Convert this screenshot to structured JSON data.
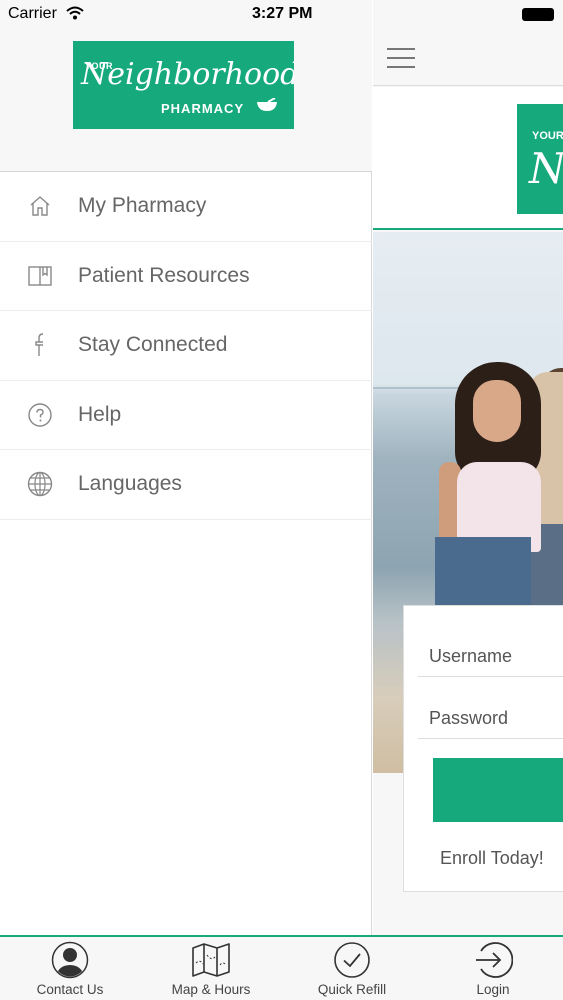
{
  "status_bar": {
    "carrier": "Carrier",
    "time": "3:27 PM"
  },
  "drawer": {
    "logo": {
      "your": "YOUR",
      "script": "Neighborhood",
      "sub": "PHARMACY"
    },
    "items": [
      {
        "label": "My Pharmacy",
        "icon": "home-icon"
      },
      {
        "label": "Patient Resources",
        "icon": "book-icon"
      },
      {
        "label": "Stay Connected",
        "icon": "facebook-icon"
      },
      {
        "label": "Help",
        "icon": "question-icon"
      },
      {
        "label": "Languages",
        "icon": "globe-icon"
      }
    ]
  },
  "main": {
    "banner_logo": {
      "your": "YOUR",
      "script": "N"
    },
    "login": {
      "username_placeholder": "Username",
      "password_placeholder": "Password",
      "enroll_text": "Enroll Today!"
    }
  },
  "tabbar": {
    "tabs": [
      {
        "label": "Contact Us",
        "icon": "person-icon"
      },
      {
        "label": "Map & Hours",
        "icon": "map-icon"
      },
      {
        "label": "Quick Refill",
        "icon": "check-circle-icon"
      },
      {
        "label": "Login",
        "icon": "login-arrow-icon"
      }
    ]
  },
  "colors": {
    "brand_green": "#16a97c",
    "menu_text": "#666666",
    "header_bg": "#f7f7f7"
  }
}
